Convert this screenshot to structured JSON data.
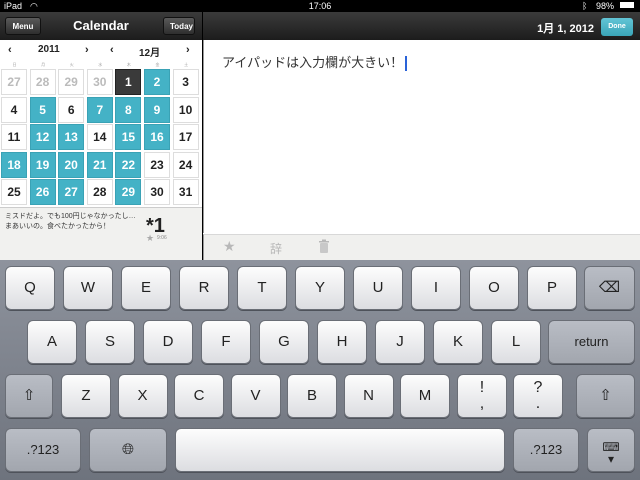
{
  "status": {
    "device": "iPad",
    "time": "17:06",
    "battery": "98%"
  },
  "left_header": {
    "menu_label": "Menu",
    "title": "Calendar",
    "today_label": "Today"
  },
  "nav": {
    "year": "2011",
    "month": "12月",
    "prev": "‹",
    "next": "›"
  },
  "calendar": {
    "weekdays": [
      "日",
      "月",
      "火",
      "水",
      "木",
      "金",
      "土"
    ],
    "weeks": [
      [
        {
          "d": "27",
          "s": "muted"
        },
        {
          "d": "28",
          "s": "muted"
        },
        {
          "d": "29",
          "s": "muted"
        },
        {
          "d": "30",
          "s": "muted"
        },
        {
          "d": "1",
          "s": "today"
        },
        {
          "d": "2",
          "s": "hl"
        },
        {
          "d": "3",
          "s": ""
        }
      ],
      [
        {
          "d": "4",
          "s": ""
        },
        {
          "d": "5",
          "s": "hl"
        },
        {
          "d": "6",
          "s": ""
        },
        {
          "d": "7",
          "s": "hl"
        },
        {
          "d": "8",
          "s": "hl"
        },
        {
          "d": "9",
          "s": "hl"
        },
        {
          "d": "10",
          "s": ""
        }
      ],
      [
        {
          "d": "11",
          "s": ""
        },
        {
          "d": "12",
          "s": "hl"
        },
        {
          "d": "13",
          "s": "hl"
        },
        {
          "d": "14",
          "s": ""
        },
        {
          "d": "15",
          "s": "hl"
        },
        {
          "d": "16",
          "s": "hl"
        },
        {
          "d": "17",
          "s": ""
        }
      ],
      [
        {
          "d": "18",
          "s": "hl"
        },
        {
          "d": "19",
          "s": "hl"
        },
        {
          "d": "20",
          "s": "hl"
        },
        {
          "d": "21",
          "s": "hl"
        },
        {
          "d": "22",
          "s": "hl"
        },
        {
          "d": "23",
          "s": ""
        },
        {
          "d": "24",
          "s": ""
        }
      ],
      [
        {
          "d": "25",
          "s": ""
        },
        {
          "d": "26",
          "s": "hl"
        },
        {
          "d": "27",
          "s": "hl"
        },
        {
          "d": "28",
          "s": ""
        },
        {
          "d": "29",
          "s": "hl"
        },
        {
          "d": "30",
          "s": ""
        },
        {
          "d": "31",
          "s": ""
        }
      ]
    ]
  },
  "note": {
    "text": "ミスドだよ。でも100円じゃなかったし…まあいいの。食べたかったから！",
    "number": "*1",
    "time": "9:06"
  },
  "right_header": {
    "date": "1月 1, 2012",
    "done_label": "Done"
  },
  "editor": {
    "text": "アイパッドは入力欄が大きい！"
  },
  "toolbar": {
    "star_icon": "star-icon",
    "dict_icon": "dictionary-icon",
    "trash_icon": "trash-icon"
  },
  "keyboard": {
    "row1": [
      "Q",
      "W",
      "E",
      "R",
      "T",
      "Y",
      "U",
      "I",
      "O",
      "P"
    ],
    "row2": [
      "A",
      "S",
      "D",
      "F",
      "G",
      "H",
      "J",
      "K",
      "L"
    ],
    "row3": [
      "Z",
      "X",
      "C",
      "V",
      "B",
      "N",
      "M"
    ],
    "row3_punct": [
      {
        "top": "!",
        "bottom": ","
      },
      {
        "top": "?",
        "bottom": "."
      }
    ],
    "return_label": "return",
    "numbers_label": ".?123"
  },
  "colors": {
    "highlight": "#44b2c6",
    "today": "#3a3a3a",
    "done": "#44b2c6"
  }
}
